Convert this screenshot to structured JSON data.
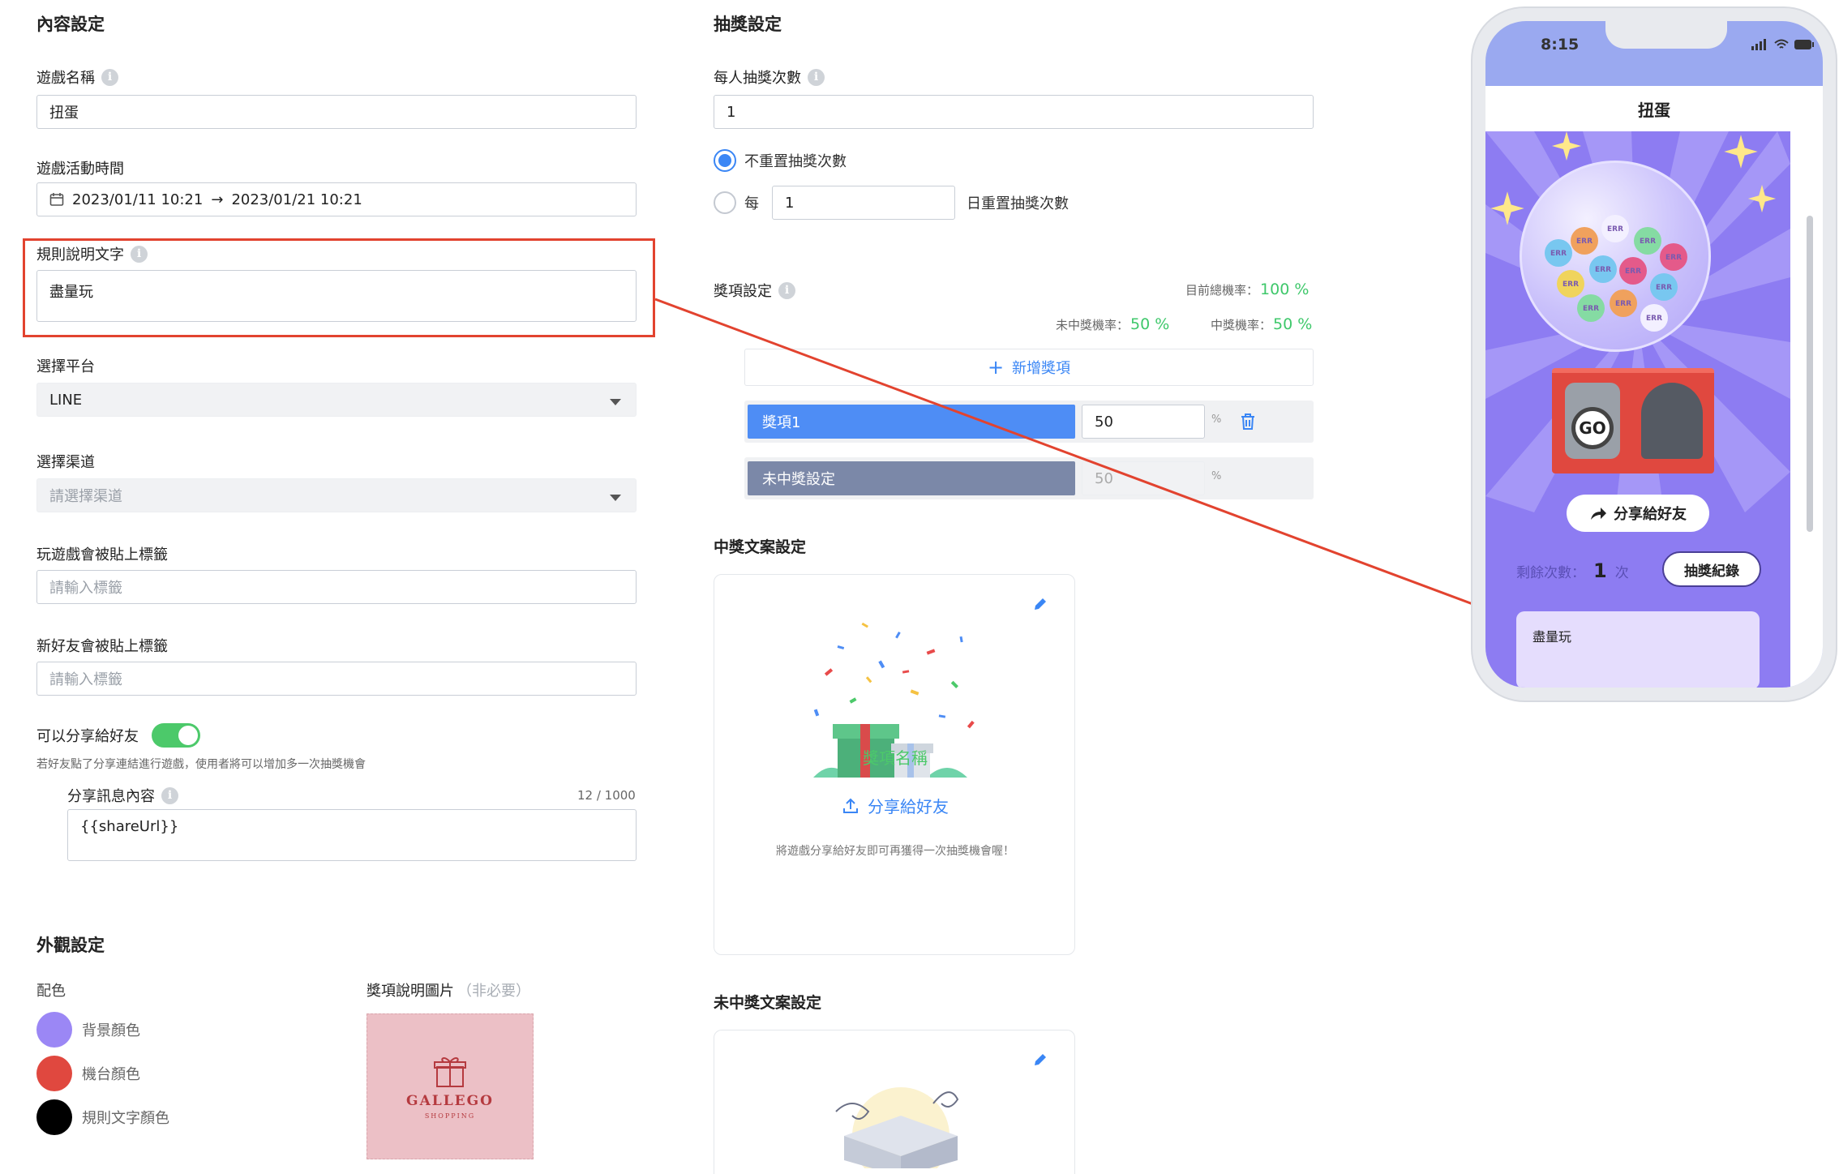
{
  "content_settings": {
    "title": "內容設定",
    "game_name": {
      "label": "遊戲名稱",
      "value": "扭蛋"
    },
    "game_time": {
      "label": "遊戲活動時間",
      "start": "2023/01/11 10:21",
      "arrow": "→",
      "end": "2023/01/21 10:21"
    },
    "rules_text": {
      "label": "規則說明文字",
      "value": "盡量玩"
    },
    "platform": {
      "label": "選擇平台",
      "value": "LINE"
    },
    "channel": {
      "label": "選擇渠道",
      "placeholder": "請選擇渠道"
    },
    "play_tag": {
      "label": "玩遊戲會被貼上標籤",
      "placeholder": "請輸入標籤"
    },
    "friend_tag": {
      "label": "新好友會被貼上標籤",
      "placeholder": "請輸入標籤"
    },
    "share": {
      "label": "可以分享給好友",
      "enabled": true,
      "hint": "若好友點了分享連結進行遊戲，使用者將可以增加多一次抽獎機會",
      "message_label": "分享訊息內容",
      "counter": "12 / 1000",
      "message_value": "{{shareUrl}}"
    }
  },
  "appearance": {
    "title": "外觀設定",
    "colors_label": "配色",
    "colors": [
      {
        "name": "背景顏色",
        "color": "#9b87f5"
      },
      {
        "name": "機台顏色",
        "color": "#e0483f"
      },
      {
        "name": "規則文字顏色",
        "color": "#000000"
      }
    ],
    "prize_image_label": "獎項說明圖片",
    "prize_image_optional": "（非必要）",
    "logo_text": "GALLEGO",
    "logo_sub": "SHOPPING"
  },
  "draw_settings": {
    "title": "抽獎設定",
    "per_person": {
      "label": "每人抽獎次數",
      "value": "1"
    },
    "no_reset_label": "不重置抽獎次數",
    "reset_every_label": "每",
    "reset_days_value": "1",
    "reset_suffix": "日重置抽獎次數",
    "selected_option": "no_reset"
  },
  "prize_settings": {
    "title": "獎項設定",
    "total_label": "目前總機率：",
    "total_value": "100 %",
    "miss_label": "未中獎機率：",
    "miss_value": "50 %",
    "win_label": "中獎機率：",
    "win_value": "50 %",
    "add_button": "新增獎項",
    "prizes": [
      {
        "name": "獎項1",
        "value": "50",
        "unit": "%"
      }
    ],
    "miss_row": {
      "name": "未中獎設定",
      "value": "50",
      "unit": "%"
    }
  },
  "win_copy": {
    "title": "中獎文案設定",
    "prize_name": "獎項名稱",
    "share_button": "分享給好友",
    "share_hint": "將遊戲分享給好友即可再獲得一次抽獎機會喔！"
  },
  "miss_copy": {
    "title": "未中獎文案設定"
  },
  "phone": {
    "time": "8:15",
    "title": "扭蛋",
    "go_label": "GO",
    "capsule_mark": "ERR",
    "share_button": "分享給好友",
    "remaining_label": "剩餘次數：",
    "remaining_value": "1",
    "remaining_unit": "次",
    "history_button": "抽獎紀錄",
    "rules_text": "盡量玩"
  }
}
